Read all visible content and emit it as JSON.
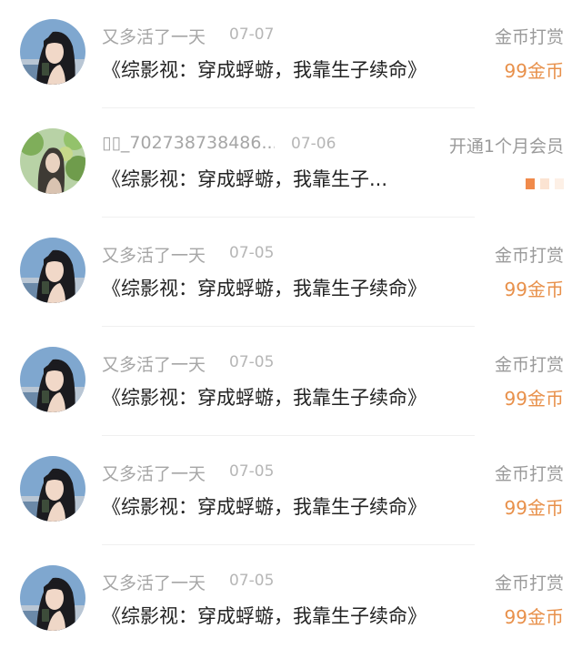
{
  "colors": {
    "accent": "#e8904a",
    "secondary_text": "#a6a6a6",
    "primary_text": "#222222"
  },
  "records": [
    {
      "user": "又多活了一天",
      "date": "07-07",
      "title": "《综影视：穿成蜉蝣，我靠生子续命》",
      "action": "金币打赏",
      "amount": "99金币",
      "avatar": "girl-dark-hair"
    },
    {
      "user": "▯▯_702738738486...",
      "date": "07-06",
      "title": "《综影视：穿成蜉蝣，我靠生子...",
      "action": "开通1个月会员",
      "amount": "",
      "avatar": "girl-green-leaves"
    },
    {
      "user": "又多活了一天",
      "date": "07-05",
      "title": "《综影视：穿成蜉蝣，我靠生子续命》",
      "action": "金币打赏",
      "amount": "99金币",
      "avatar": "girl-dark-hair"
    },
    {
      "user": "又多活了一天",
      "date": "07-05",
      "title": "《综影视：穿成蜉蝣，我靠生子续命》",
      "action": "金币打赏",
      "amount": "99金币",
      "avatar": "girl-dark-hair"
    },
    {
      "user": "又多活了一天",
      "date": "07-05",
      "title": "《综影视：穿成蜉蝣，我靠生子续命》",
      "action": "金币打赏",
      "amount": "99金币",
      "avatar": "girl-dark-hair"
    },
    {
      "user": "又多活了一天",
      "date": "07-05",
      "title": "《综影视：穿成蜉蝣，我靠生子续命》",
      "action": "金币打赏",
      "amount": "99金币",
      "avatar": "girl-dark-hair"
    }
  ]
}
